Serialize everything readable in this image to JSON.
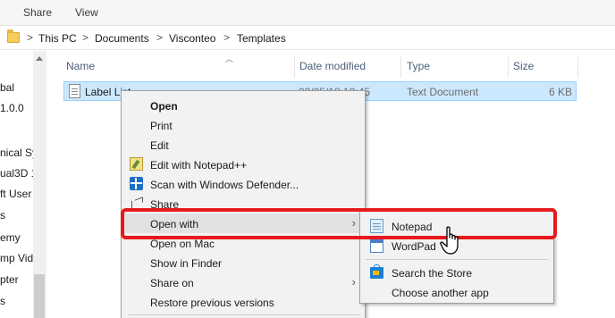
{
  "ribbon": {
    "tabs": [
      "Share",
      "View"
    ]
  },
  "addressbar": {
    "crumbs": [
      "This PC",
      "Documents",
      "Visconteo",
      "Templates"
    ],
    "separator": ">"
  },
  "navpane": {
    "items": [
      "bal",
      "1.0.0",
      "nical Sy",
      "ual3D 1",
      "ft User",
      "s",
      "emy",
      "mp Vid",
      "pter",
      "s"
    ]
  },
  "columns": {
    "name": "Name",
    "date_modified": "Date modified",
    "type": "Type",
    "size": "Size"
  },
  "file": {
    "name": "Label List",
    "date": "03/05/18 13:45",
    "type": "Text Document",
    "size": "6 KB"
  },
  "context_menu": {
    "items": [
      {
        "label": "Open",
        "bold": true
      },
      {
        "label": "Print"
      },
      {
        "label": "Edit"
      },
      {
        "label": "Edit with Notepad++",
        "icon": "notepadpp-icon"
      },
      {
        "label": "Scan with Windows Defender...",
        "icon": "defender-icon"
      },
      {
        "label": "Share",
        "icon": "share-icon"
      },
      {
        "label": "Open with",
        "submenu": true,
        "highlighted": true
      },
      {
        "label": "Open on Mac"
      },
      {
        "label": "Show in Finder"
      },
      {
        "label": "Share on",
        "submenu": true
      },
      {
        "label": "Restore previous versions"
      }
    ],
    "arrow": "›"
  },
  "open_with_submenu": {
    "items": [
      {
        "label": "Notepad",
        "icon": "notepad-icon"
      },
      {
        "label": "WordPad",
        "icon": "wordpad-icon"
      },
      {
        "label": "Search the Store",
        "icon": "store-icon"
      },
      {
        "label": "Choose another app"
      }
    ]
  },
  "colors": {
    "selection": "#cce8ff",
    "highlight_ring": "#e8191c",
    "menu_bg": "#f2f2f2"
  }
}
